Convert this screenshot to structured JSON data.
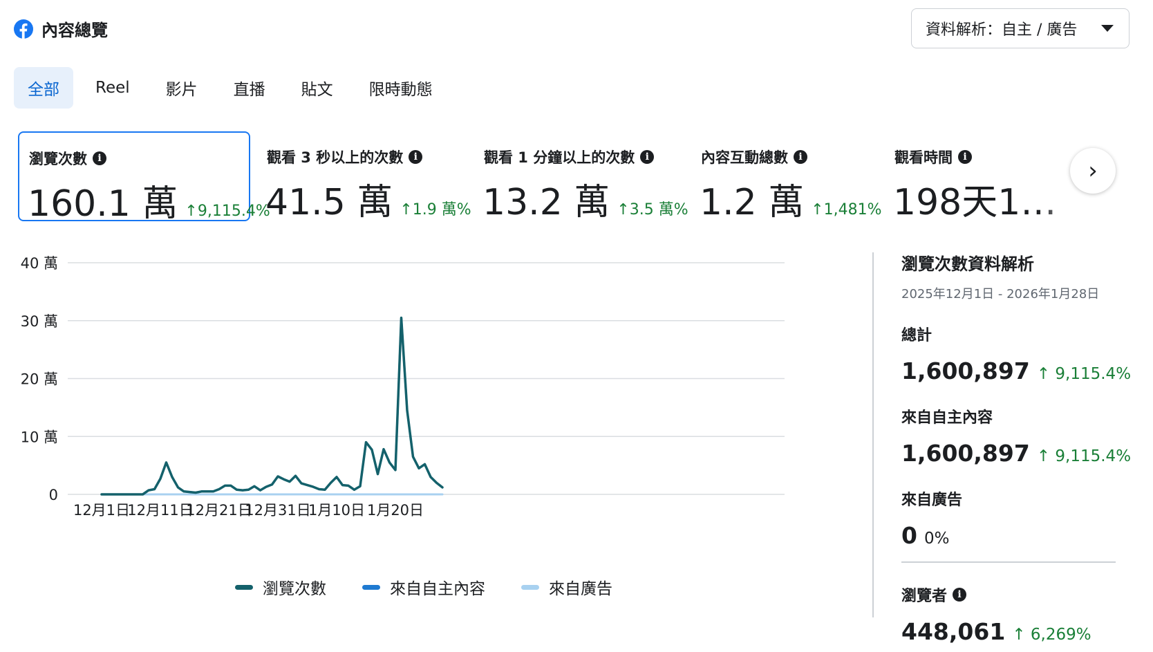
{
  "header": {
    "title": "內容總覽",
    "breakdown_label": "資料解析：自主 / 廣告"
  },
  "tabs": [
    "全部",
    "Reel",
    "影片",
    "直播",
    "貼文",
    "限時動態"
  ],
  "metrics": [
    {
      "label": "瀏覽次數",
      "value": "160.1 萬",
      "delta": "9,115.4%"
    },
    {
      "label": "觀看 3 秒以上的次數",
      "value": "41.5 萬",
      "delta": "1.9 萬%"
    },
    {
      "label": "觀看 1 分鐘以上的次數",
      "value": "13.2 萬",
      "delta": "3.5 萬%"
    },
    {
      "label": "內容互動總數",
      "value": "1.2 萬",
      "delta": "1,481%"
    },
    {
      "label": "觀看時間",
      "value": "198天1…"
    }
  ],
  "chart_data": {
    "type": "line",
    "x_tick_labels": [
      "12月1日",
      "12月11日",
      "12月21日",
      "12月31日",
      "1月10日",
      "1月20日"
    ],
    "y_tick_labels": [
      "0",
      "10 萬",
      "20 萬",
      "30 萬",
      "40 萬"
    ],
    "ylim": [
      0,
      400000
    ],
    "x": [
      "12/1",
      "12/2",
      "12/3",
      "12/4",
      "12/5",
      "12/6",
      "12/7",
      "12/8",
      "12/9",
      "12/10",
      "12/11",
      "12/12",
      "12/13",
      "12/14",
      "12/15",
      "12/16",
      "12/17",
      "12/18",
      "12/19",
      "12/20",
      "12/21",
      "12/22",
      "12/23",
      "12/24",
      "12/25",
      "12/26",
      "12/27",
      "12/28",
      "12/29",
      "12/30",
      "12/31",
      "1/1",
      "1/2",
      "1/3",
      "1/4",
      "1/5",
      "1/6",
      "1/7",
      "1/8",
      "1/9",
      "1/10",
      "1/11",
      "1/12",
      "1/13",
      "1/14",
      "1/15",
      "1/16",
      "1/17",
      "1/18",
      "1/19",
      "1/20",
      "1/21",
      "1/22",
      "1/23",
      "1/24",
      "1/25",
      "1/26",
      "1/27",
      "1/28"
    ],
    "series": [
      {
        "name": "瀏覽次數",
        "color": "#14616b",
        "values": [
          0,
          0,
          0,
          0,
          0,
          0,
          0,
          0,
          7000,
          9000,
          27000,
          55000,
          30000,
          12000,
          5000,
          4000,
          3000,
          5000,
          5000,
          5000,
          9000,
          15000,
          15000,
          8000,
          7000,
          8000,
          14000,
          7000,
          13000,
          17000,
          31000,
          26000,
          22000,
          32000,
          19000,
          16000,
          13000,
          9000,
          8000,
          20000,
          30000,
          16000,
          15000,
          8000,
          14000,
          90000,
          77000,
          35000,
          78000,
          55000,
          42000,
          305000,
          145000,
          65000,
          45000,
          52000,
          30000,
          20000,
          12000
        ]
      },
      {
        "name": "來自自主內容",
        "color": "#1f7ad1",
        "values": [
          0,
          0,
          0,
          0,
          0,
          0,
          0,
          0,
          7000,
          9000,
          27000,
          55000,
          30000,
          12000,
          5000,
          4000,
          3000,
          5000,
          5000,
          5000,
          9000,
          15000,
          15000,
          8000,
          7000,
          8000,
          14000,
          7000,
          13000,
          17000,
          31000,
          26000,
          22000,
          32000,
          19000,
          16000,
          13000,
          9000,
          8000,
          20000,
          30000,
          16000,
          15000,
          8000,
          14000,
          90000,
          77000,
          35000,
          78000,
          55000,
          42000,
          305000,
          145000,
          65000,
          45000,
          52000,
          30000,
          20000,
          12000
        ]
      },
      {
        "name": "來自廣告",
        "color": "#a8d1f0",
        "values": [
          0,
          0,
          0,
          0,
          0,
          0,
          0,
          0,
          0,
          0,
          0,
          0,
          0,
          0,
          0,
          0,
          0,
          0,
          0,
          0,
          0,
          0,
          0,
          0,
          0,
          0,
          0,
          0,
          0,
          0,
          0,
          0,
          0,
          0,
          0,
          0,
          0,
          0,
          0,
          0,
          0,
          0,
          0,
          0,
          0,
          0,
          0,
          0,
          0,
          0,
          0,
          0,
          0,
          0,
          0,
          0,
          0,
          0,
          0
        ]
      }
    ],
    "legend_placement": "bottom",
    "grid": true
  },
  "side": {
    "title": "瀏覽次數資料解析",
    "range": "2025年12月1日 - 2026年1月28日",
    "total_label": "總計",
    "total_value": "1,600,897",
    "total_delta": "9,115.4%",
    "organic_label": "來自自主內容",
    "organic_value": "1,600,897",
    "organic_delta": "9,115.4%",
    "ads_label": "來自廣告",
    "ads_value": "0",
    "ads_delta": "0%",
    "viewers_label": "瀏覽者",
    "viewers_value": "448,061",
    "viewers_delta": "6,269%"
  },
  "icons": {
    "logo": "facebook-logo-icon",
    "info": "info-icon",
    "next": "chevron-right-icon",
    "dropdown": "caret-down-icon",
    "up": "arrow-up-icon"
  },
  "colors": {
    "accent": "#1877f2",
    "positive": "#1a7f37",
    "tab_active_bg": "#e7f0fb"
  }
}
